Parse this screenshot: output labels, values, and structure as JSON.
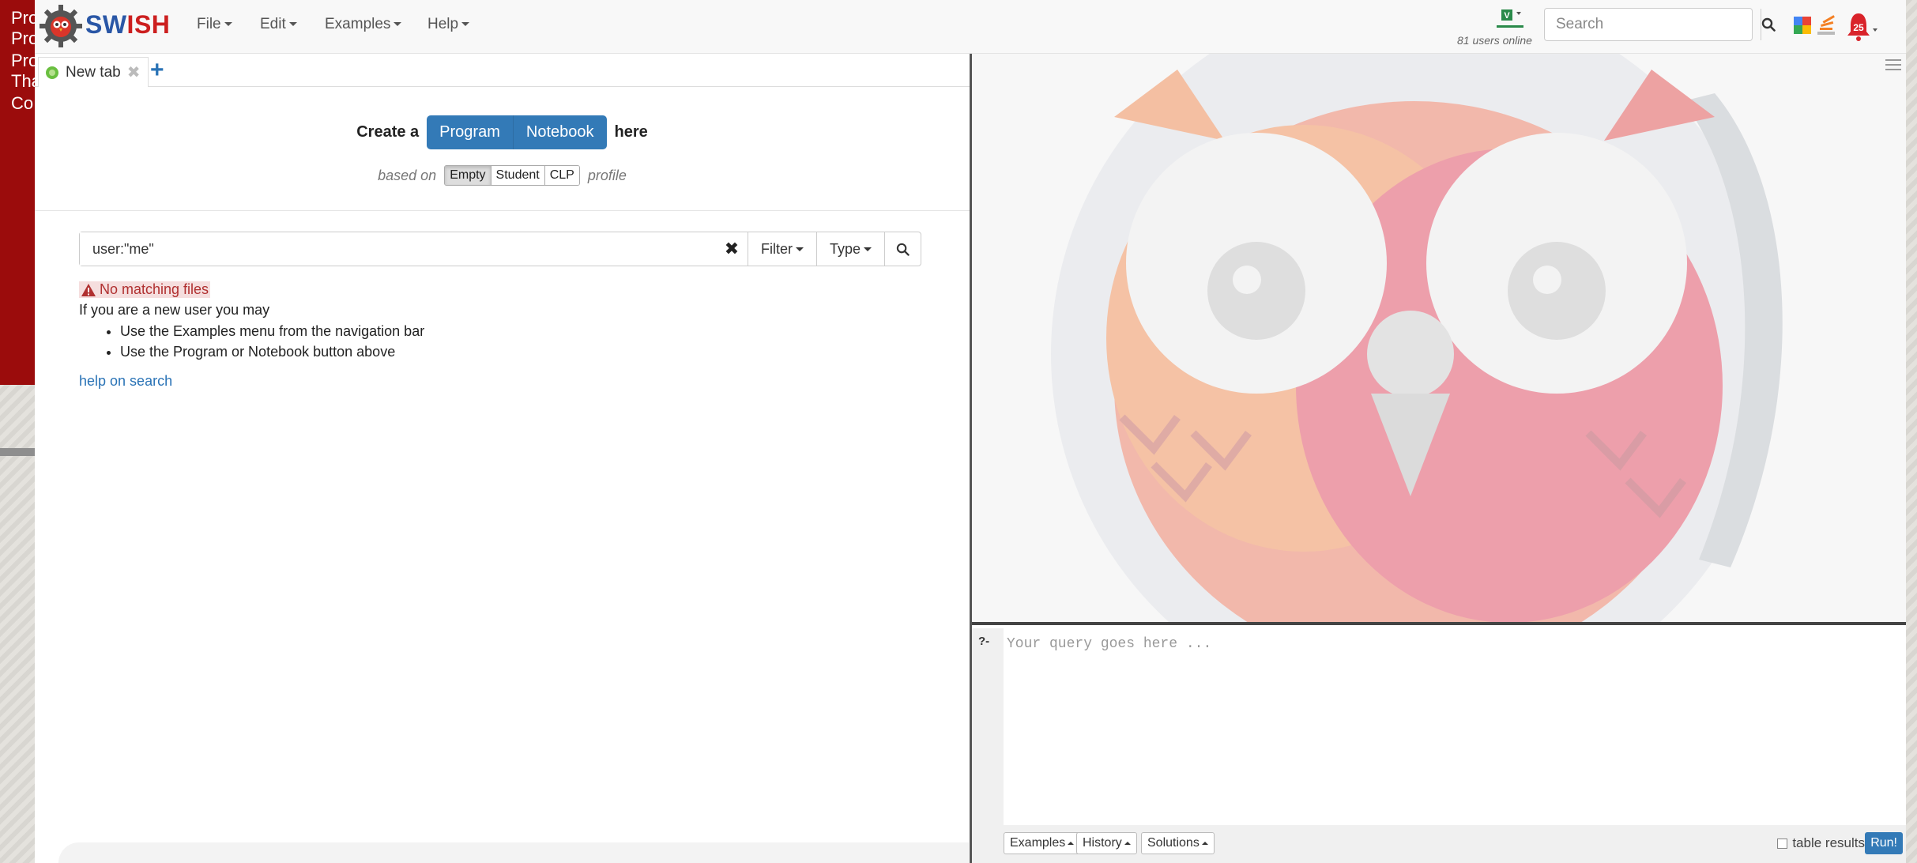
{
  "background": {
    "side_items": [
      "Pro",
      "Pro",
      "Pro",
      "Tha",
      "Co"
    ]
  },
  "navbar": {
    "brand_prefix": "SW",
    "brand_suffix": "ISH",
    "menus": [
      "File",
      "Edit",
      "Examples",
      "Help"
    ],
    "users_online": "81 users online",
    "search_placeholder": "Search",
    "notification_count": "25"
  },
  "editor": {
    "tabs": [
      {
        "label": "New tab"
      }
    ],
    "create": {
      "prefix": "Create a",
      "buttons": [
        "Program",
        "Notebook"
      ],
      "suffix": "here"
    },
    "profile": {
      "prefix": "based on",
      "options": [
        "Empty",
        "Student",
        "CLP"
      ],
      "selected": "Empty",
      "suffix": "profile"
    },
    "file_search": {
      "value": "user:\"me\"",
      "filter_label": "Filter",
      "type_label": "Type"
    },
    "results": {
      "alert": "No matching files",
      "intro": "If you are a new user you may",
      "hints": [
        "Use the Examples menu from the navigation bar",
        "Use the Program or Notebook button above"
      ],
      "help_link": "help on search"
    }
  },
  "query": {
    "prompt": "?-",
    "placeholder": "Your query goes here ...",
    "toolbar": [
      "Examples",
      "History",
      "Solutions"
    ],
    "table_results_label": "table results",
    "table_results_checked": false,
    "run_label": "Run!"
  },
  "colors": {
    "brand_blue": "#2a57a6",
    "brand_red": "#cc1f1f",
    "button_blue": "#337ab7",
    "sidebar_red": "#9b0c0c"
  }
}
